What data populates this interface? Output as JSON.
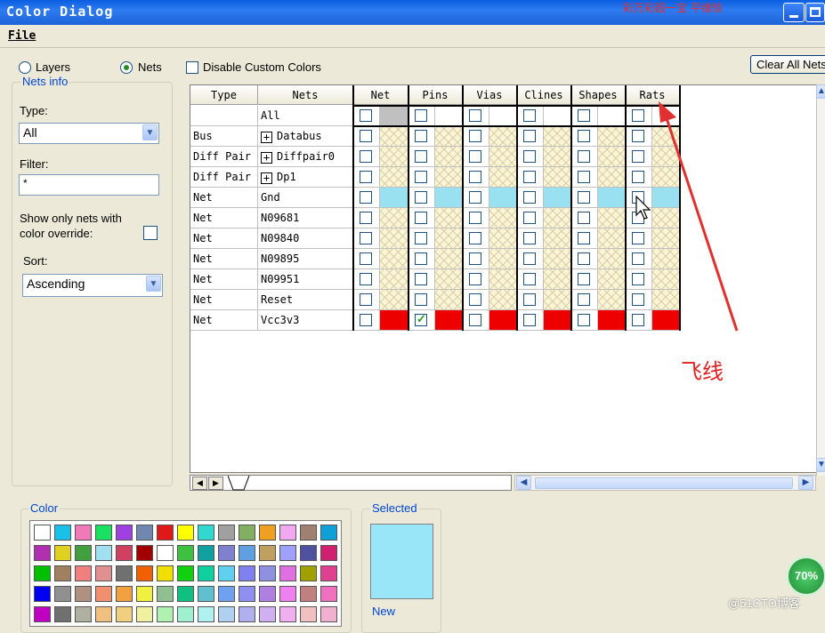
{
  "window": {
    "title": "Color Dialog",
    "title_overlay": "彩万彩超一宝 平维验"
  },
  "menu": {
    "file_label": "File"
  },
  "view_mode": {
    "layers_label": "Layers",
    "nets_label": "Nets",
    "selected": "Nets"
  },
  "disable_custom_colors_label": "Disable Custom Colors",
  "clear_all_button_label": "Clear All Nets",
  "nets_info": {
    "title": "Nets info",
    "type_label": "Type:",
    "type_value": "All",
    "filter_label": "Filter:",
    "filter_value": "*",
    "override_label_line1": "Show only nets with",
    "override_label_line2": "color override:",
    "sort_label": "Sort:",
    "sort_value": "Ascending"
  },
  "grid": {
    "headers": [
      "Type",
      "Nets",
      "Net",
      "Pins",
      "Vias",
      "Clines",
      "Shapes",
      "Rats"
    ],
    "rows": [
      {
        "type": "",
        "net": "All",
        "expand": false,
        "style": "all"
      },
      {
        "type": "Bus",
        "net": "Databus",
        "expand": true,
        "style": "hatch"
      },
      {
        "type": "Diff Pair",
        "net": "Diffpair0",
        "expand": true,
        "style": "hatch"
      },
      {
        "type": "Diff Pair",
        "net": "Dp1",
        "expand": true,
        "style": "hatch"
      },
      {
        "type": "Net",
        "net": "Gnd",
        "expand": false,
        "style": "cyan"
      },
      {
        "type": "Net",
        "net": "N09681",
        "expand": false,
        "style": "hatch"
      },
      {
        "type": "Net",
        "net": "N09840",
        "expand": false,
        "style": "hatch"
      },
      {
        "type": "Net",
        "net": "N09895",
        "expand": false,
        "style": "hatch"
      },
      {
        "type": "Net",
        "net": "N09951",
        "expand": false,
        "style": "hatch"
      },
      {
        "type": "Net",
        "net": "Reset",
        "expand": false,
        "style": "hatch"
      },
      {
        "type": "Net",
        "net": "Vcc3v3",
        "expand": false,
        "style": "red",
        "checked": "Pins"
      }
    ],
    "colors": {
      "cyan": "#99e0f0",
      "red": "#ee0000",
      "all": "#c0c0c0"
    }
  },
  "color_panel": {
    "title": "Color",
    "swatches": [
      "#ffffff",
      "#19c0e8",
      "#f07ab8",
      "#19e060",
      "#a040e0",
      "#7088b0",
      "#e01818",
      "#ffff00",
      "#30d8d0",
      "#a0a0a0",
      "#80b060",
      "#f0a020",
      "#f0a8f0",
      "#a08070",
      "#10a0d8",
      "#b030b0",
      "#e0d020",
      "#40a040",
      "#a0e0f0",
      "#d04060",
      "#a00000",
      "#ffffff",
      "#40c040",
      "#10a0a0",
      "#8080d0",
      "#60a0e0",
      "#c0a060",
      "#a0a0ff",
      "#5050a0",
      "#d02070",
      "#00c000",
      "#a08060",
      "#f08080",
      "#e09090",
      "#707070",
      "#f06000",
      "#f0e000",
      "#10d010",
      "#10d0a0",
      "#60d0f0",
      "#8080f0",
      "#9090e0",
      "#e070e0",
      "#a0a000",
      "#e04090",
      "#0000f0",
      "#909090",
      "#b09080",
      "#f09070",
      "#f0a040",
      "#f0f040",
      "#90c090",
      "#10c080",
      "#60c0d0",
      "#70a0f0",
      "#9090f0",
      "#b080e0",
      "#f080f0",
      "#c08080",
      "#f070c0",
      "#c000c0",
      "#707070",
      "#b0b0a0",
      "#f0c080",
      "#f0d080",
      "#f0f0a0",
      "#b0f0b0",
      "#a0f0d0",
      "#b0f0f0",
      "#b0d0f0",
      "#b0b0f0",
      "#d0b0f0",
      "#f0b0f0",
      "#f0c0c0",
      "#f0b0d0"
    ]
  },
  "selected_panel": {
    "title": "Selected",
    "color": "#99e6f8",
    "new_label": "New"
  },
  "annotation": {
    "text": "飞线"
  },
  "badge": {
    "text": "70%"
  },
  "watermark": "@51CTO博客"
}
